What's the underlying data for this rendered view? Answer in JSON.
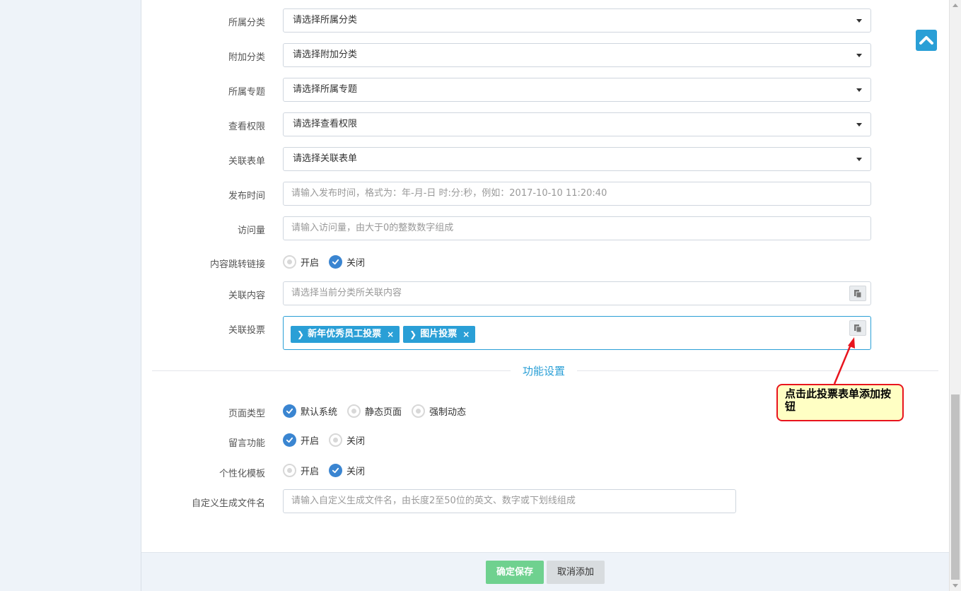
{
  "fields": {
    "category": {
      "label": "所属分类",
      "value": "请选择所属分类"
    },
    "extra_category": {
      "label": "附加分类",
      "value": "请选择附加分类"
    },
    "topic": {
      "label": "所属专题",
      "value": "请选择所属专题"
    },
    "view_permission": {
      "label": "查看权限",
      "value": "请选择查看权限"
    },
    "linked_form": {
      "label": "关联表单",
      "value": "请选择关联表单"
    },
    "publish_time": {
      "label": "发布时间",
      "placeholder": "请输入发布时间，格式为：年-月-日 时:分:秒，例如：2017-10-10 11:20:40"
    },
    "visits": {
      "label": "访问量",
      "placeholder": "请输入访问量，由大于0的整数数字组成"
    },
    "jump_link": {
      "label": "内容跳转链接",
      "options": [
        "开启",
        "关闭"
      ],
      "selected": "关闭"
    },
    "linked_content": {
      "label": "关联内容",
      "placeholder": "请选择当前分类所关联内容"
    },
    "linked_vote": {
      "label": "关联投票",
      "tags": [
        "新年优秀员工投票",
        "图片投票"
      ],
      "remove_symbol": "×"
    }
  },
  "section_title": "功能设置",
  "settings": {
    "page_type": {
      "label": "页面类型",
      "options": [
        "默认系统",
        "静态页面",
        "强制动态"
      ],
      "selected": "默认系统"
    },
    "comment": {
      "label": "留言功能",
      "options": [
        "开启",
        "关闭"
      ],
      "selected": "开启"
    },
    "custom_template": {
      "label": "个性化模板",
      "options": [
        "开启",
        "关闭"
      ],
      "selected": "关闭"
    },
    "filename": {
      "label": "自定义生成文件名",
      "placeholder": "请输入自定义生成文件名，由长度2至50位的英文、数字或下划线组成"
    }
  },
  "footer": {
    "save_label": "确定保存",
    "cancel_label": "取消添加"
  },
  "callout": {
    "text": "点击此投票表单添加按钮"
  },
  "colors": {
    "accent": "#2a9fd6",
    "save": "#6fd18f",
    "callout_border": "#e8141e",
    "callout_bg": "#ffffc4"
  },
  "icons": {
    "to_top": "chevron-up-icon",
    "picker": "copy-icon",
    "caret": "caret-down-icon",
    "check": "check-icon"
  }
}
